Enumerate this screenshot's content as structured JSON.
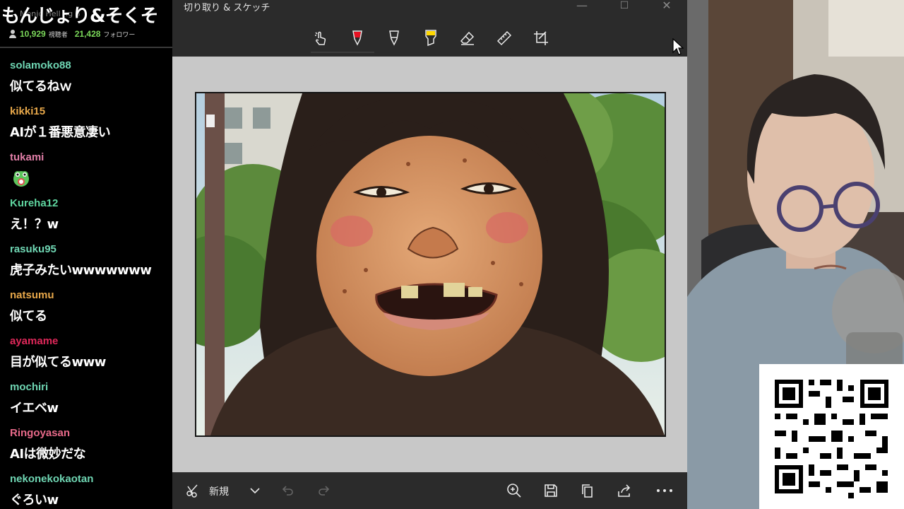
{
  "overlay": {
    "stream_title": "もんじょり&そくそ",
    "stream_title_ghost": "Monjo  Hell    ng     6",
    "viewers_count": "10,929",
    "viewers_label": "視聴者",
    "followers_count": "21,428",
    "followers_label": "フォロワー"
  },
  "chat": {
    "messages": [
      {
        "user": "solamoko88",
        "color": "#6fd6b3",
        "text": "似てるねｗ"
      },
      {
        "user": "kikki15",
        "color": "#e8a84a",
        "text": "AIが１番悪意凄い"
      },
      {
        "user": "tukami",
        "color": "#e27fa8",
        "text": "",
        "emote": "frog-emote"
      },
      {
        "user": "Kureha12",
        "color": "#5fd6a0",
        "text": "え！？w"
      },
      {
        "user": "rasuku95",
        "color": "#6fd6b3",
        "text": "虎子みたいwwwwwww"
      },
      {
        "user": "natsumu",
        "color": "#e8a84a",
        "text": "似てる"
      },
      {
        "user": "ayamame",
        "color": "#e0285a",
        "text": "目が似てるwww"
      },
      {
        "user": "mochiri",
        "color": "#6fd6b3",
        "text": "イエベw"
      },
      {
        "user": "Ringoyasan",
        "color": "#e86a8a",
        "text": "AIは微妙だな"
      },
      {
        "user": "nekonekokaotan",
        "color": "#6fd6b3",
        "text": "ぐろいw"
      }
    ]
  },
  "app": {
    "title": "切り取り & スケッチ",
    "window_controls": [
      "—",
      "☐",
      "✕"
    ],
    "toolbar_icons": [
      "touch-writing-icon",
      "ballpoint-pen-icon",
      "pencil-icon",
      "highlighter-icon",
      "eraser-icon",
      "ruler-icon",
      "crop-icon"
    ],
    "accent_colors": {
      "pen": "#e81123",
      "highlighter": "#ffd800"
    },
    "bottom": {
      "new_label": "新規",
      "left_icons": [
        "new-snip-icon",
        "chevron-down-icon",
        "undo-icon",
        "redo-icon"
      ],
      "right_icons": [
        "zoom-icon",
        "save-icon",
        "copy-icon",
        "share-icon",
        "more-icon"
      ]
    }
  }
}
